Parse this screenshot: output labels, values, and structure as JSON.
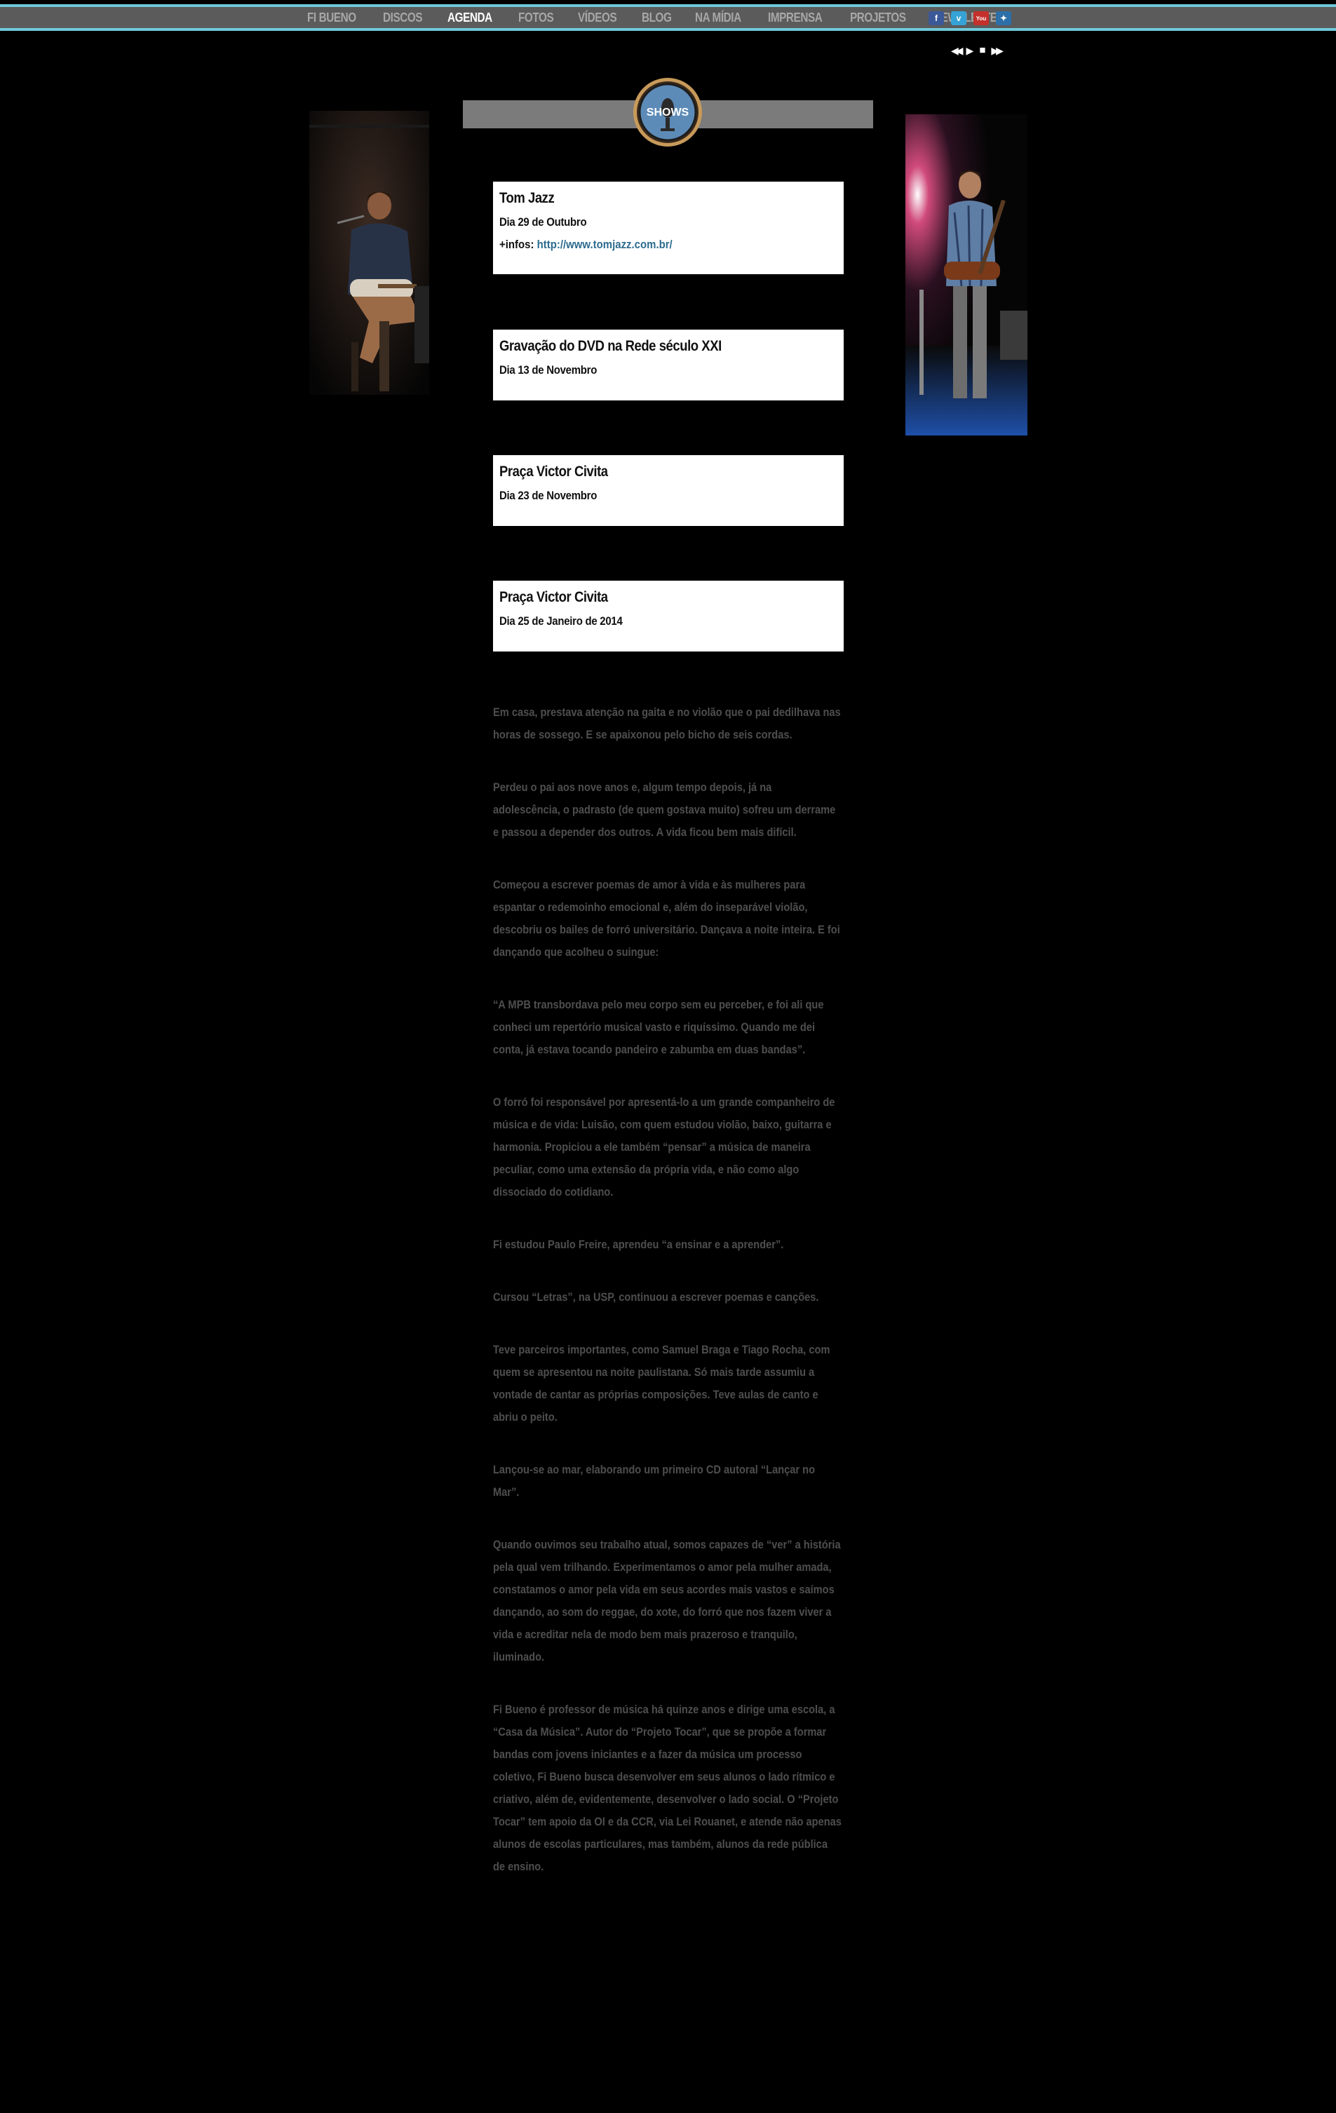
{
  "nav": {
    "items": [
      "FI BUENO",
      "DISCOS",
      "AGENDA",
      "FOTOS",
      "VÍDEOS",
      "BLOG",
      "NA MÍDIA",
      "IMPRENSA",
      "PROJETOS",
      "NEWSLETTER"
    ],
    "active": "AGENDA",
    "social": [
      {
        "name": "facebook-icon",
        "glyph": "f"
      },
      {
        "name": "vimeo-icon",
        "glyph": "v"
      },
      {
        "name": "youtube-icon",
        "glyph": "You"
      },
      {
        "name": "myspace-icon",
        "glyph": "✦"
      }
    ]
  },
  "player": {
    "rewind": "◀◀",
    "play": "▶",
    "stop": "■",
    "forward": "▶▶"
  },
  "header": {
    "badge_label": "SHOWS"
  },
  "events": [
    {
      "title": "Tom Jazz",
      "date": "Dia 29 de Outubro",
      "info_label": "+infos:",
      "info_link": "http://www.tomjazz.com.br/"
    },
    {
      "title": "Gravação do DVD na Rede século XXI",
      "date": "Dia 13 de Novembro"
    },
    {
      "title": "Praça Victor Civita",
      "date": "Dia 23 de Novembro"
    },
    {
      "title": "Praça Victor Civita",
      "date": "Dia 25 de Janeiro de 2014"
    }
  ],
  "bio": [
    "Em casa, prestava atenção na gaita e no violão que o pai dedilhava nas horas de sossego. E se apaixonou pelo bicho de seis cordas.",
    "Perdeu o pai aos nove anos e, algum tempo depois, já na adolescência, o padrasto (de quem gostava muito) sofreu um derrame e passou a depender dos outros. A vida ficou bem mais difícil.",
    "Começou a escrever poemas de amor à vida e às mulheres para espantar o redemoinho emocional e, além do inseparável violão, descobriu os bailes de forró universitário. Dançava a noite inteira. E foi dançando que acolheu o suingue:",
    "“A MPB transbordava pelo meu corpo sem eu perceber, e foi ali que conheci um repertório musical vasto e riquíssimo. Quando me dei conta, já estava tocando pandeiro e zabumba em duas bandas”.",
    "O forró foi responsável por apresentá-lo a um grande companheiro de música e de vida: Luisão, com quem estudou violão, baixo, guitarra e harmonia. Propiciou a ele também “pensar” a música de maneira peculiar, como uma extensão da própria vida, e não como algo dissociado do cotidiano.",
    "Fi estudou Paulo Freire, aprendeu “a ensinar e a aprender”.",
    "Cursou “Letras”, na USP, continuou a escrever poemas e canções.",
    "Teve parceiros importantes, como Samuel Braga e Tiago Rocha, com quem se apresentou na noite paulistana. Só mais tarde assumiu a vontade de cantar as próprias composições. Teve aulas de canto e abriu o peito.",
    "Lançou-se ao mar, elaborando um primeiro CD autoral “Lançar no Mar”.",
    "Quando ouvimos seu trabalho atual, somos capazes de “ver” a história pela qual vem trilhando. Experimentamos o amor pela mulher amada, constatamos o amor pela vida em seus acordes mais vastos e saímos dançando, ao som do reggae, do xote, do forró que nos fazem viver a vida e acreditar nela de modo bem mais prazeroso e tranquilo, iluminado.",
    "Fi Bueno é professor de música há quinze anos e dirige uma escola, a “Casa da Música”. Autor do “Projeto Tocar”, que se propõe a formar bandas com jovens iniciantes e a fazer da música um processo coletivo, Fi Bueno busca desenvolver em seus alunos o lado rítmico e criativo, além de, evidentemente, desenvolver o lado social. O “Projeto Tocar” tem apoio da OI e da CCR, via Lei Rouanet, e atende não apenas alunos de escolas particulares, mas também, alunos da rede pública de ensino."
  ]
}
